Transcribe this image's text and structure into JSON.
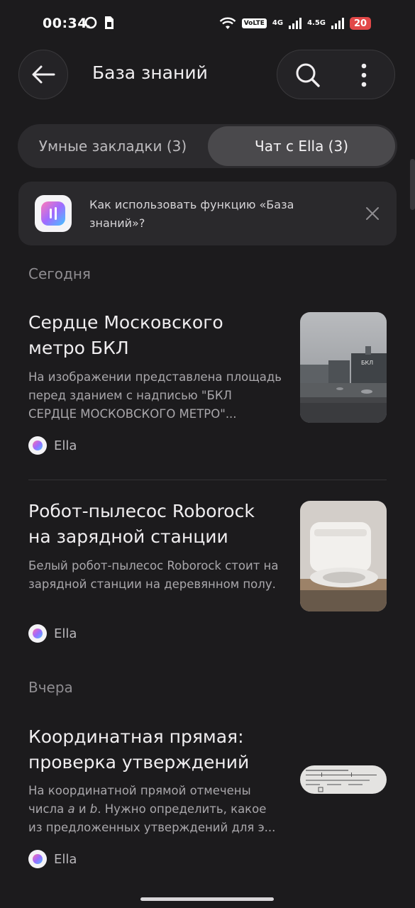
{
  "status_bar": {
    "time": "00:34",
    "volte": "VoLTE",
    "net1": "4G",
    "net2": "4.5G",
    "battery": "20"
  },
  "header": {
    "title": "База знаний"
  },
  "tabs": [
    {
      "label": "Умные закладки (3)",
      "active": false
    },
    {
      "label": "Чат с Ella (3)",
      "active": true
    }
  ],
  "banner": {
    "text": "Как использовать функцию «База знаний»?"
  },
  "sections": [
    {
      "label": "Сегодня",
      "items": [
        {
          "title": "Сердце Московского метро БКЛ",
          "description": "На изображении представлена площадь перед зданием с надписью \"БКЛ СЕРДЦЕ МОСКОВСКОГО МЕТРО\"...",
          "source": "Ella",
          "thumb_sign": "БКЛ"
        },
        {
          "title": "Робот-пылесос Roborock на зарядной станции",
          "description": "Белый робот-пылесос Roborock стоит на зарядной станции на деревянном полу.",
          "source": "Ella"
        }
      ]
    },
    {
      "label": "Вчера",
      "items": [
        {
          "title": "Координатная прямая: проверка утверждений",
          "description_parts": [
            "На координатной прямой отмечены числа ",
            "a",
            " и ",
            "b",
            ". Нужно определить, какое из предложенных утверждений для э..."
          ],
          "source": "Ella"
        }
      ]
    }
  ],
  "colors": {
    "background": "#1c1b1d",
    "battery": "#e24848",
    "active_tab": "#4a494c"
  }
}
